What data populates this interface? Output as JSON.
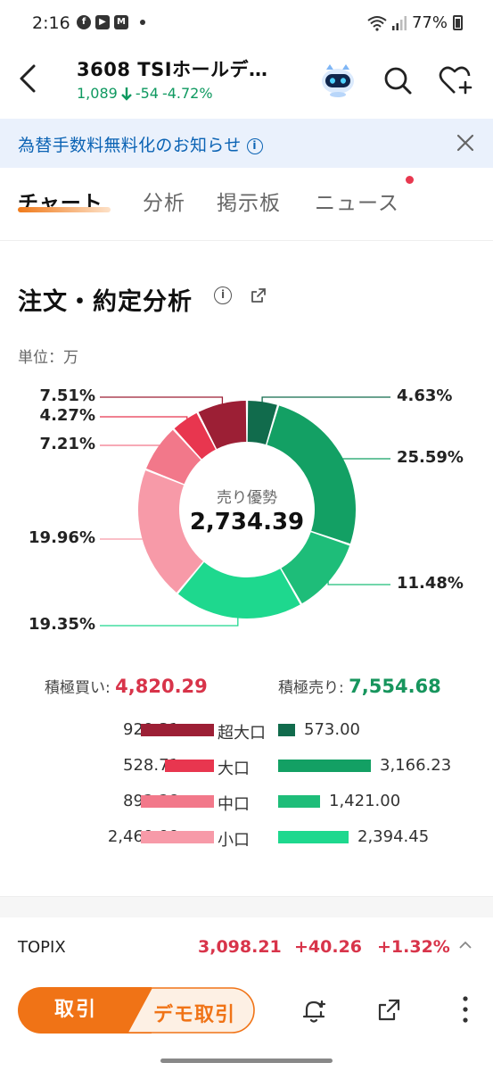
{
  "status": {
    "time": "2:16",
    "battery": "77%"
  },
  "header": {
    "title": "3608  TSIホールデ…",
    "price": "1,089",
    "change": "-54",
    "change_pct": "-4.72%"
  },
  "notice": {
    "text": "為替手数料無料化のお知らせ",
    "info_icon": "i"
  },
  "tabs": [
    {
      "label": "チャート"
    },
    {
      "label": "分析"
    },
    {
      "label": "掲示板"
    },
    {
      "label": "ニュース"
    }
  ],
  "section": {
    "title": "注文・約定分析",
    "info_icon": "i",
    "unit": "単位：万"
  },
  "colors": {
    "buy_extra_large": "#9c1f35",
    "buy_large": "#e8364f",
    "buy_medium": "#f2788a",
    "buy_small": "#f79aa8",
    "sell_extra_large": "#116b4c",
    "sell_large": "#13a064",
    "sell_medium": "#1ebd79",
    "sell_small": "#1ed88e",
    "accent": "#f07316"
  },
  "chart_data": {
    "type": "pie",
    "center_label": "売り優勢",
    "center_value": "2,734.39",
    "slices": [
      {
        "label": "4.63%",
        "value": 4.63,
        "color": "#116b4c"
      },
      {
        "label": "25.59%",
        "value": 25.59,
        "color": "#13a064"
      },
      {
        "label": "11.48%",
        "value": 11.48,
        "color": "#1ebd79"
      },
      {
        "label": "19.35%",
        "value": 19.35,
        "color": "#1ed88e"
      },
      {
        "label": "19.96%",
        "value": 19.96,
        "color": "#f79aa8"
      },
      {
        "label": "7.21%",
        "value": 7.21,
        "color": "#f2788a"
      },
      {
        "label": "4.27%",
        "value": 4.27,
        "color": "#e8364f"
      },
      {
        "label": "7.51%",
        "value": 7.51,
        "color": "#9c1f35"
      }
    ]
  },
  "totals": {
    "buy_label": "積極買い:",
    "buy_value": "4,820.29",
    "sell_label": "積極売り:",
    "sell_value": "7,554.68"
  },
  "tiers": [
    {
      "name": "超大口",
      "buy": "929.31",
      "buy_num": 929.31,
      "sell": "573.00",
      "sell_num": 573.0,
      "buy_color": "#9c1f35",
      "sell_color": "#116b4c"
    },
    {
      "name": "大口",
      "buy": "528.71",
      "buy_num": 528.71,
      "sell": "3,166.23",
      "sell_num": 3166.23,
      "buy_color": "#e8364f",
      "sell_color": "#13a064"
    },
    {
      "name": "中口",
      "buy": "892.28",
      "buy_num": 892.28,
      "sell": "1,421.00",
      "sell_num": 1421.0,
      "buy_color": "#f2788a",
      "sell_color": "#1ebd79"
    },
    {
      "name": "小口",
      "buy": "2,469.99",
      "buy_num": 2469.99,
      "sell": "2,394.45",
      "sell_num": 2394.45,
      "buy_color": "#f79aa8",
      "sell_color": "#1ed88e"
    }
  ],
  "index": {
    "name": "TOPIX",
    "value": "3,098.21",
    "change": "+40.26",
    "change_pct": "+1.32%"
  },
  "bottom": {
    "trade_label": "取引",
    "demo_label": "デモ取引"
  }
}
